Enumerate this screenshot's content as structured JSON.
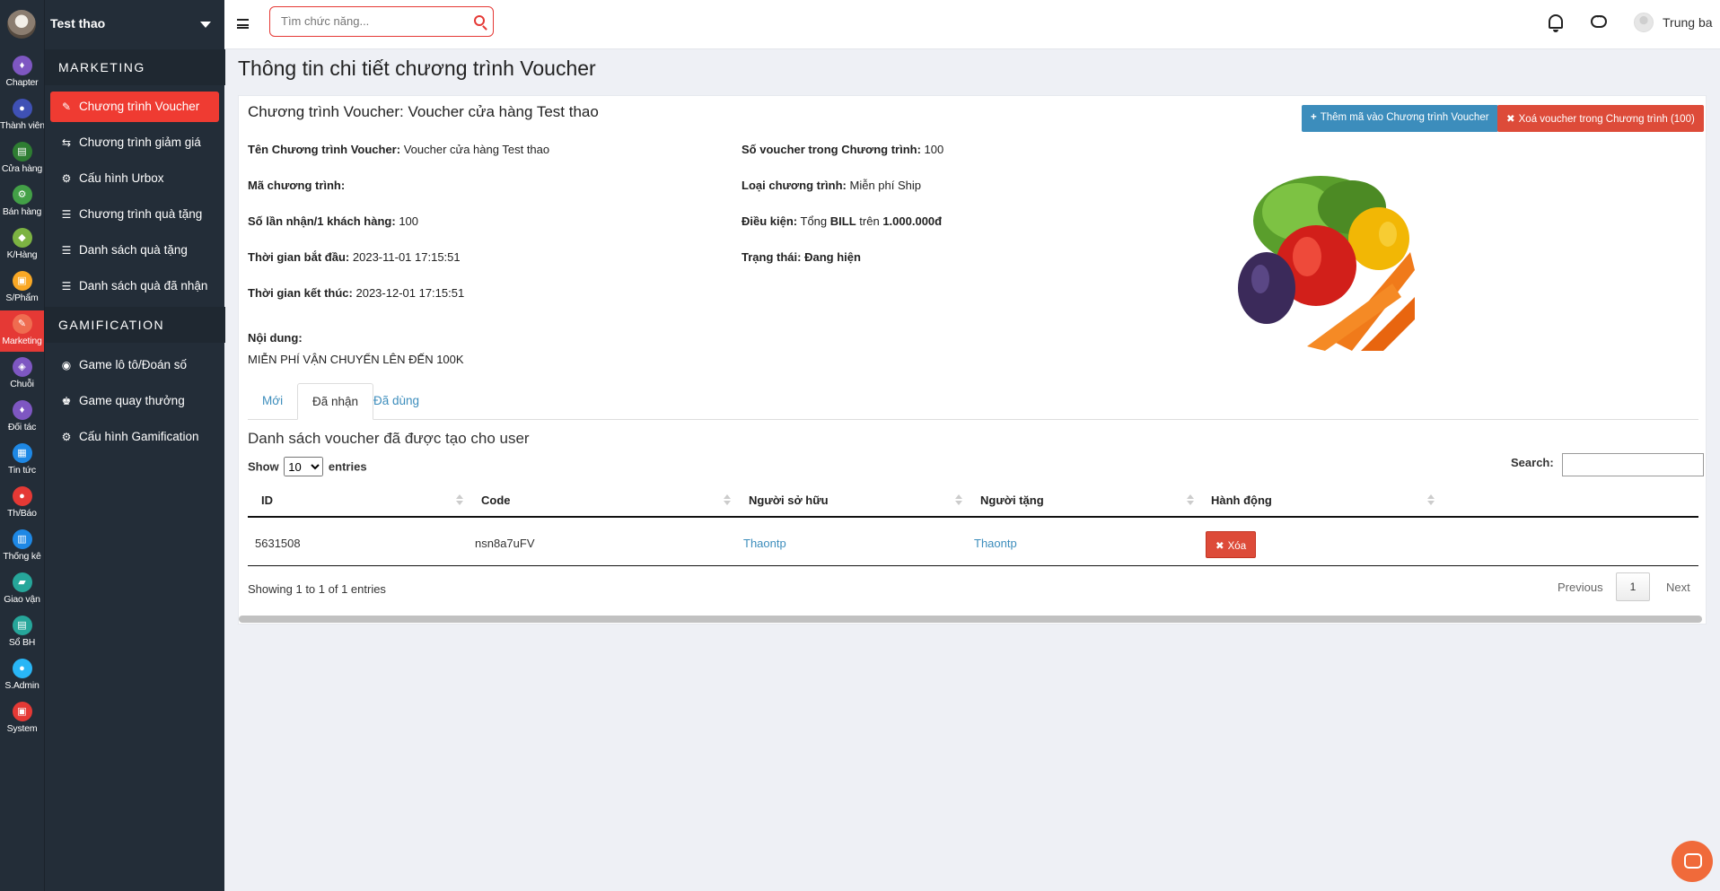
{
  "brand": {
    "shop_name": "Test thao"
  },
  "rail": [
    {
      "label": "Chapter",
      "color": "#7e57c2",
      "glyph": "♦"
    },
    {
      "label": "Thành viên",
      "color": "#3f51b5",
      "glyph": "●"
    },
    {
      "label": "Cửa hàng",
      "color": "#2e7d32",
      "glyph": "▤"
    },
    {
      "label": "Bán hàng",
      "color": "#43a047",
      "glyph": "⚙"
    },
    {
      "label": "K/Hàng",
      "color": "#7cb342",
      "glyph": "◆"
    },
    {
      "label": "S/Phẩm",
      "color": "#f9a825",
      "glyph": "▣"
    },
    {
      "label": "Marketing",
      "color": "#ef6c50",
      "glyph": "✎"
    },
    {
      "label": "Chuỗi",
      "color": "#7e57c2",
      "glyph": "◈"
    },
    {
      "label": "Đối tác",
      "color": "#7e57c2",
      "glyph": "♦"
    },
    {
      "label": "Tin tức",
      "color": "#1e88e5",
      "glyph": "▦"
    },
    {
      "label": "Th/Báo",
      "color": "#e53935",
      "glyph": "●"
    },
    {
      "label": "Thống kê",
      "color": "#1e88e5",
      "glyph": "▥"
    },
    {
      "label": "Giao vận",
      "color": "#26a69a",
      "glyph": "▰"
    },
    {
      "label": "Sổ BH",
      "color": "#26a69a",
      "glyph": "▤"
    },
    {
      "label": "S.Admin",
      "color": "#29b6f6",
      "glyph": "●"
    },
    {
      "label": "System",
      "color": "#e53935",
      "glyph": "▣"
    }
  ],
  "menu": {
    "marketing_title": "MARKETING",
    "marketing_items": [
      {
        "label": "Chương trình Voucher",
        "glyph": "✎"
      },
      {
        "label": "Chương trình giảm giá",
        "glyph": "⇆"
      },
      {
        "label": "Cấu hình Urbox",
        "glyph": "⚙"
      },
      {
        "label": "Chương trình quà tặng",
        "glyph": "☰"
      },
      {
        "label": "Danh sách quà tặng",
        "glyph": "☰"
      },
      {
        "label": "Danh sách quà đã nhận",
        "glyph": "☰"
      }
    ],
    "gamification_title": "GAMIFICATION",
    "gamification_items": [
      {
        "label": "Game lô tô/Đoán số",
        "glyph": "◉"
      },
      {
        "label": "Game quay thưởng",
        "glyph": "♚"
      },
      {
        "label": "Cấu hình Gamification",
        "glyph": "⚙"
      }
    ]
  },
  "topbar": {
    "search_placeholder": "Tìm chức năng...",
    "user_name": "Trung ba"
  },
  "page": {
    "title": "Thông tin chi tiết chương trình Voucher",
    "card_title": "Chương trình Voucher: Voucher cửa hàng Test thao",
    "btn_add": "Thêm mã vào Chương trình Voucher",
    "btn_add_glyph": "+",
    "btn_delete_all": "Xoá voucher trong Chương trình (100)",
    "btn_delete_glyph": "✖",
    "fields": {
      "name_label": "Tên Chương trình Voucher:",
      "name_value": "Voucher cửa hàng Test thao",
      "code_label": "Mã chương trình:",
      "code_value": "",
      "times_label": "Số lần nhận/1 khách hàng:",
      "times_value": "100",
      "start_label": "Thời gian bắt đầu:",
      "start_value": "2023-11-01 17:15:51",
      "end_label": "Thời gian kết thúc:",
      "end_value": "2023-12-01 17:15:51",
      "content_label": "Nội dung:",
      "content_value": "MIỄN PHÍ VẬN CHUYỂN LÊN ĐẾN 100K",
      "count_label": "Số voucher trong Chương trình:",
      "count_value": "100",
      "type_label": "Loại chương trình:",
      "type_value": "Miễn phí Ship",
      "cond_label": "Điều kiện:",
      "cond_prefix": "Tổng",
      "cond_bill": "BILL",
      "cond_mid": "trên",
      "cond_amount": "1.000.000đ",
      "status_label": "Trạng thái:",
      "status_value": "Đang hiện"
    },
    "tabs": [
      "Mới",
      "Đã nhận",
      "Đã dùng"
    ],
    "list_title": "Danh sách voucher đã được tạo cho user",
    "show_label": "Show",
    "entries_label": "entries",
    "page_length": "10",
    "search_label": "Search:",
    "columns": [
      "ID",
      "Code",
      "Người sở hữu",
      "Người tặng",
      "Hành động"
    ],
    "rows": [
      {
        "id": "5631508",
        "code": "nsn8a7uFV",
        "owner": "Thaontp",
        "giver": "Thaontp",
        "action": "Xóa",
        "action_glyph": "✖"
      }
    ],
    "info": "Showing 1 to 1 of 1 entries",
    "prev": "Previous",
    "next": "Next",
    "current_page": "1"
  }
}
